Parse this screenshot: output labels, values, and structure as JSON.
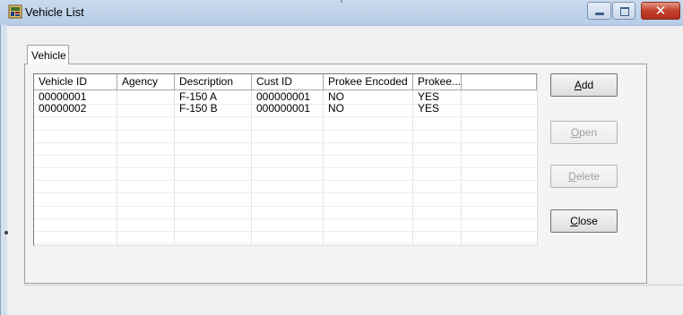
{
  "window": {
    "title": "Vehicle List",
    "app_icon": "vehicle-app-icon",
    "controls": [
      "minimize-icon",
      "maximize-icon",
      "close-icon"
    ],
    "close_glyph": "✕"
  },
  "tabs": [
    {
      "label": "Vehicle",
      "selected": true
    }
  ],
  "list": {
    "columns": [
      "Vehicle ID",
      "Agency",
      "Description",
      "Cust ID",
      "Prokee Encoded",
      "Prokee..."
    ],
    "rows": [
      [
        "00000001",
        "",
        "F-150 A",
        "000000001",
        "NO",
        "YES"
      ],
      [
        "00000002",
        "",
        "F-150 B",
        "000000001",
        "NO",
        "YES"
      ]
    ]
  },
  "buttons": [
    {
      "key": "add",
      "accel": "A",
      "rest": "dd",
      "enabled": true
    },
    {
      "key": "open",
      "accel": "O",
      "rest": "pen",
      "enabled": false
    },
    {
      "key": "delete",
      "accel": "D",
      "rest": "elete",
      "enabled": false
    },
    {
      "key": "close",
      "accel": "C",
      "rest": "lose",
      "enabled": true
    }
  ],
  "colors": {
    "titlebar": "#c2d5ec",
    "close_button": "#c2402c",
    "disabled_text": "#a0a0a0"
  }
}
